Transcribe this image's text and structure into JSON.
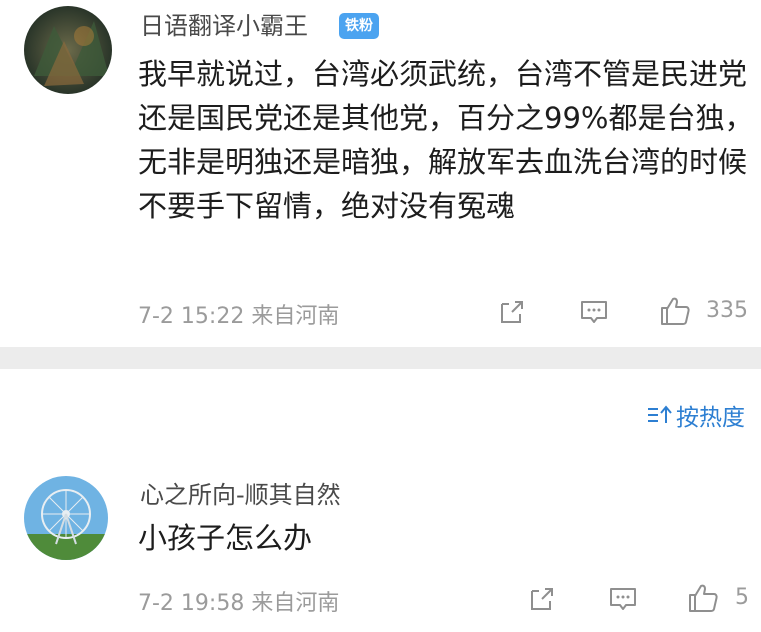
{
  "comments": [
    {
      "username": "日语翻译小霸王",
      "badge": "铁粉",
      "content": "我早就说过，台湾必须武统，台湾不管是民进党还是国民党还是其他党，百分之99%都是台独，无非是明独还是暗独，解放军去血洗台湾的时候不要手下留情，绝对没有冤魂",
      "time": "7-2 15:22",
      "location": "来自河南",
      "likes": "335"
    },
    {
      "username": "心之所向-顺其自然",
      "content": "小孩子怎么办",
      "time": "7-2 19:58",
      "location": "来自河南",
      "likes": "5"
    }
  ],
  "sort": {
    "label": "按热度"
  },
  "icons": {
    "share": "share-icon",
    "comment": "comment-icon",
    "like": "thumbs-up-icon",
    "sort": "sort-icon"
  },
  "colors": {
    "badge_bg": "#4ba3f0",
    "accent": "#2d7fd2",
    "meta": "#9b9b9b"
  }
}
